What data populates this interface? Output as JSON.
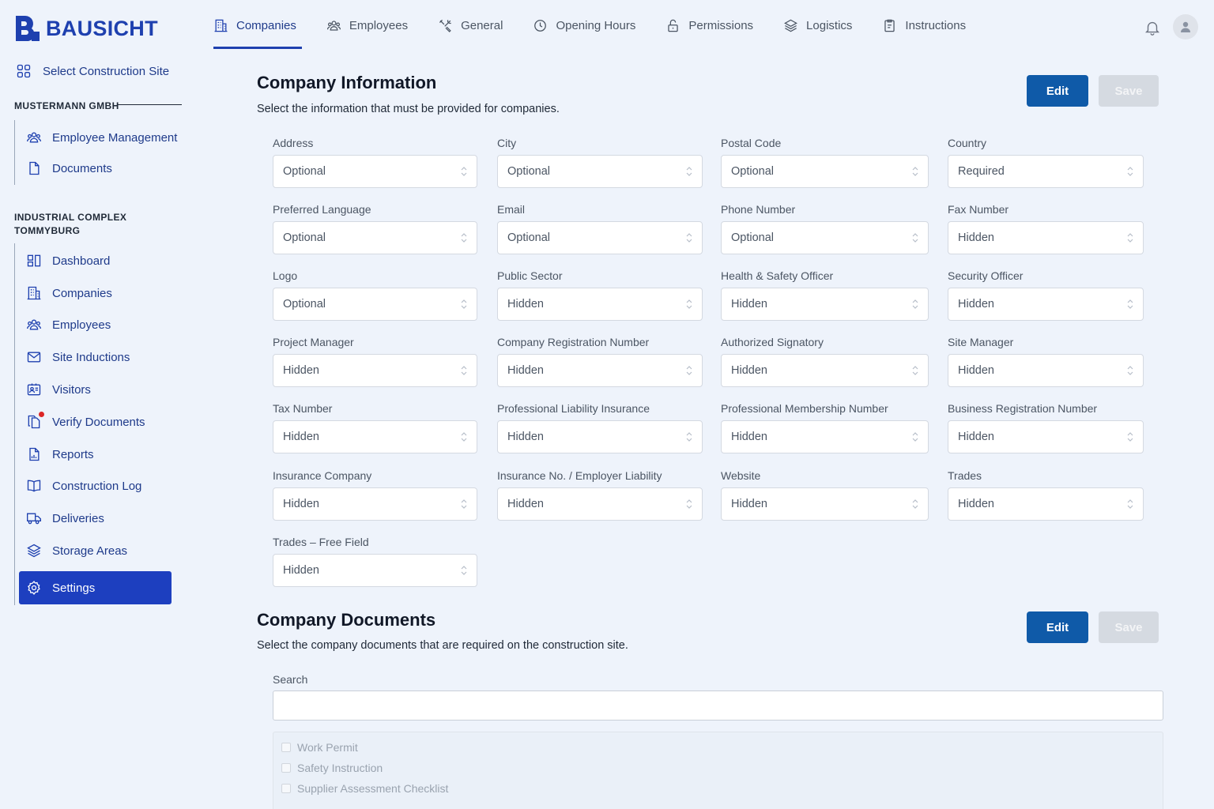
{
  "brand": {
    "name": "BAUSICHT"
  },
  "sidebar": {
    "select_site": "Select Construction Site",
    "org1": "MUSTERMANN GMBH",
    "org1_items": [
      {
        "label": "Employee Management",
        "icon": "users-icon"
      },
      {
        "label": "Documents",
        "icon": "document-icon"
      }
    ],
    "org2": "INDUSTRIAL COMPLEX TOMMYBURG",
    "org2_items": [
      {
        "label": "Dashboard",
        "icon": "dashboard-icon"
      },
      {
        "label": "Companies",
        "icon": "building-icon"
      },
      {
        "label": "Employees",
        "icon": "users-icon"
      },
      {
        "label": "Site Inductions",
        "icon": "mail-icon"
      },
      {
        "label": "Visitors",
        "icon": "id-card-icon"
      },
      {
        "label": "Verify Documents",
        "icon": "documents-icon"
      },
      {
        "label": "Reports",
        "icon": "report-icon"
      },
      {
        "label": "Construction Log",
        "icon": "book-icon"
      },
      {
        "label": "Deliveries",
        "icon": "truck-icon"
      },
      {
        "label": "Storage Areas",
        "icon": "layers-icon"
      },
      {
        "label": "Settings",
        "icon": "gear-icon"
      }
    ]
  },
  "tabs": [
    {
      "label": "Companies",
      "icon": "building-icon"
    },
    {
      "label": "Employees",
      "icon": "users-icon"
    },
    {
      "label": "General",
      "icon": "tools-icon"
    },
    {
      "label": "Opening Hours",
      "icon": "clock-icon"
    },
    {
      "label": "Permissions",
      "icon": "lock-icon"
    },
    {
      "label": "Logistics",
      "icon": "layers-icon"
    },
    {
      "label": "Instructions",
      "icon": "clipboard-icon"
    }
  ],
  "company_info": {
    "title": "Company Information",
    "description": "Select the information that must be provided for companies.",
    "edit_label": "Edit",
    "save_label": "Save",
    "fields": [
      {
        "label": "Address",
        "value": "Optional"
      },
      {
        "label": "City",
        "value": "Optional"
      },
      {
        "label": "Postal Code",
        "value": "Optional"
      },
      {
        "label": "Country",
        "value": "Required"
      },
      {
        "label": "Preferred Language",
        "value": "Optional"
      },
      {
        "label": "Email",
        "value": "Optional"
      },
      {
        "label": "Phone Number",
        "value": "Optional"
      },
      {
        "label": "Fax Number",
        "value": "Hidden"
      },
      {
        "label": "Logo",
        "value": "Optional"
      },
      {
        "label": "Public Sector",
        "value": "Hidden"
      },
      {
        "label": "Health & Safety Officer",
        "value": "Hidden"
      },
      {
        "label": "Security Officer",
        "value": "Hidden"
      },
      {
        "label": "Project Manager",
        "value": "Hidden"
      },
      {
        "label": "Company Registration Number",
        "value": "Hidden"
      },
      {
        "label": "Authorized Signatory",
        "value": "Hidden"
      },
      {
        "label": "Site Manager",
        "value": "Hidden"
      },
      {
        "label": "Tax Number",
        "value": "Hidden"
      },
      {
        "label": "Professional Liability Insurance",
        "value": "Hidden"
      },
      {
        "label": "Professional Membership Number",
        "value": "Hidden"
      },
      {
        "label": "Business Registration Number",
        "value": "Hidden"
      },
      {
        "label": "Insurance Company",
        "value": "Hidden"
      },
      {
        "label": "Insurance No. / Employer Liability",
        "value": "Hidden"
      },
      {
        "label": "Website",
        "value": "Hidden"
      },
      {
        "label": "Trades",
        "value": "Hidden"
      },
      {
        "label": "Trades – Free Field",
        "value": "Hidden"
      }
    ]
  },
  "company_docs": {
    "title": "Company Documents",
    "description": "Select the company documents that are required on the construction site.",
    "edit_label": "Edit",
    "save_label": "Save",
    "search_label": "Search",
    "search_value": "",
    "items": [
      "Work Permit",
      "Safety Instruction",
      "Supplier Assessment Checklist"
    ]
  },
  "colors": {
    "accent": "#1e40af",
    "primary_button": "#0f5aa8",
    "active_nav": "#1d3fbf",
    "background": "#eef3fb"
  }
}
